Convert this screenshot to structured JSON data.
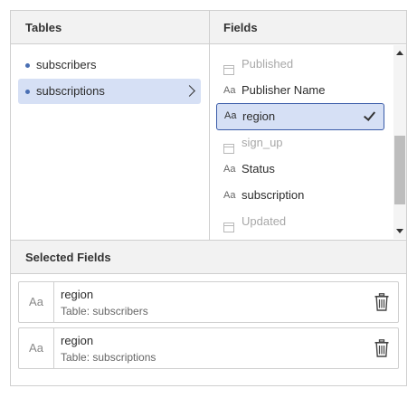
{
  "tables_header": "Tables",
  "fields_header": "Fields",
  "selected_header": "Selected Fields",
  "tables": [
    {
      "label": "subscribers",
      "selected": false
    },
    {
      "label": "subscriptions",
      "selected": true
    }
  ],
  "fields": [
    {
      "label": "Published",
      "icon": "calendar-icon",
      "disabled": true,
      "selected": false
    },
    {
      "label": "Publisher Name",
      "icon": "text-type-icon",
      "icon_text": "Aa",
      "disabled": false,
      "selected": false
    },
    {
      "label": "region",
      "icon": "text-type-icon",
      "icon_text": "Aa",
      "disabled": false,
      "selected": true
    },
    {
      "label": "sign_up",
      "icon": "calendar-icon",
      "disabled": true,
      "selected": false
    },
    {
      "label": "Status",
      "icon": "text-type-icon",
      "icon_text": "Aa",
      "disabled": false,
      "selected": false
    },
    {
      "label": "subscription",
      "icon": "text-type-icon",
      "icon_text": "Aa",
      "disabled": false,
      "selected": false
    },
    {
      "label": "Updated",
      "icon": "calendar-icon",
      "disabled": true,
      "selected": false
    }
  ],
  "selected_fields": [
    {
      "icon_text": "Aa",
      "name": "region",
      "table": "Table: subscribers"
    },
    {
      "icon_text": "Aa",
      "name": "region",
      "table": "Table: subscriptions"
    }
  ],
  "colors": {
    "selection": "#d6e0f5",
    "selection_border": "#3a5ba8",
    "bullet": "#4a6fb3"
  }
}
